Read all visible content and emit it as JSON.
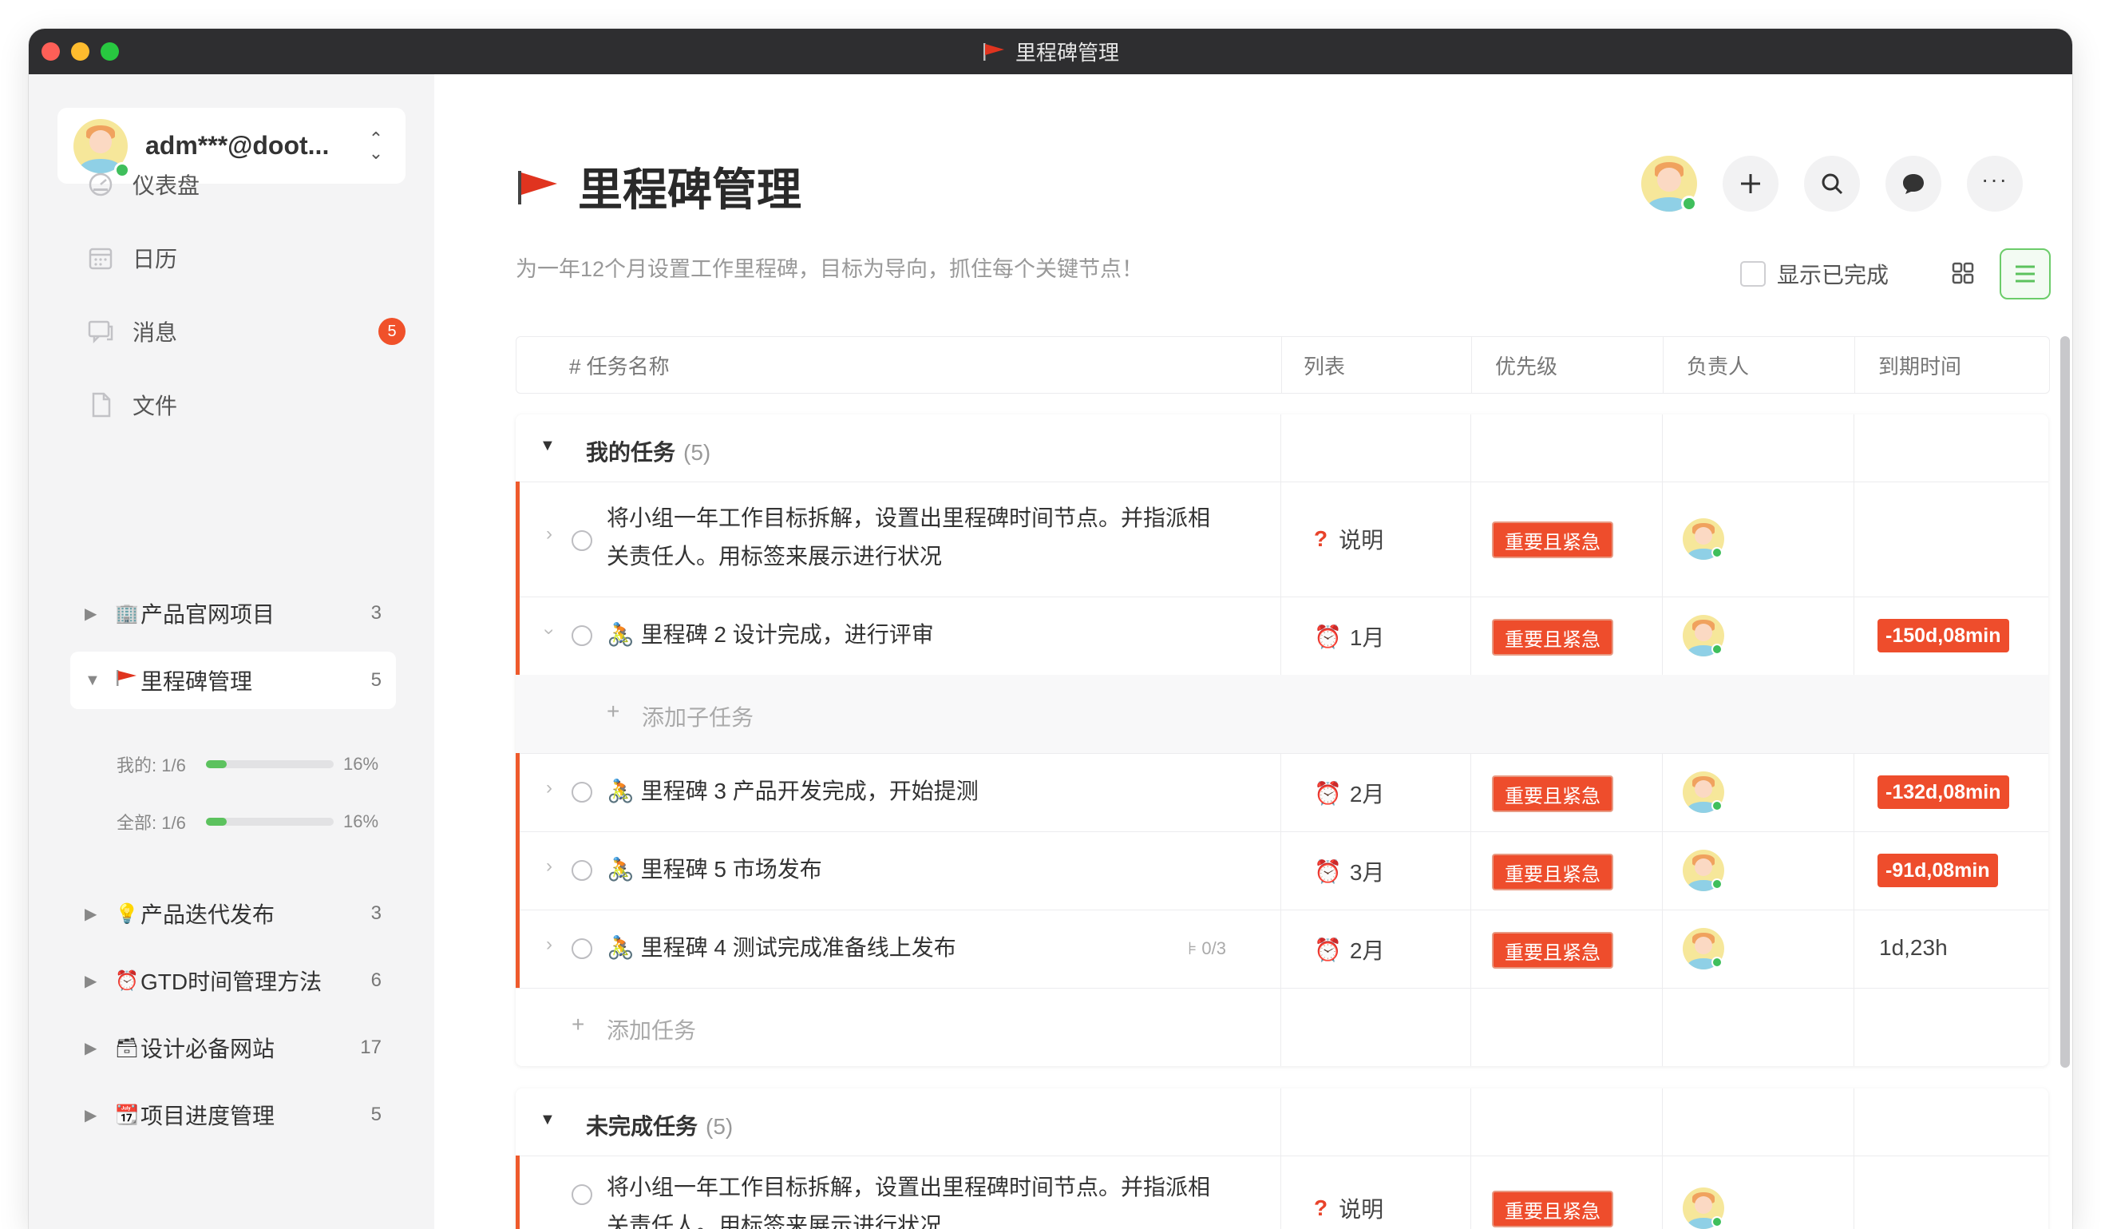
{
  "window": {
    "title": "里程碑管理"
  },
  "sidebar": {
    "account": {
      "name": "adm***@doot..."
    },
    "nav": [
      {
        "label": "仪表盘",
        "icon": "dashboard-icon"
      },
      {
        "label": "日历",
        "icon": "calendar-icon"
      },
      {
        "label": "消息",
        "icon": "message-icon",
        "badge": "5"
      },
      {
        "label": "文件",
        "icon": "file-icon"
      }
    ],
    "projects": [
      {
        "label": "产品官网项目",
        "icon": "🏢",
        "count": "3",
        "expanded": false
      },
      {
        "label": "里程碑管理",
        "icon": "flag",
        "count": "5",
        "expanded": true
      },
      {
        "label": "产品迭代发布",
        "icon": "💡",
        "count": "3",
        "expanded": false
      },
      {
        "label": "GTD时间管理方法",
        "icon": "⏰",
        "count": "6",
        "expanded": false
      },
      {
        "label": "设计必备网站",
        "icon": "🗃",
        "count": "17",
        "expanded": false
      },
      {
        "label": "项目进度管理",
        "icon": "📆",
        "count": "5",
        "expanded": false
      }
    ],
    "progress": [
      {
        "label": "我的: 1/6",
        "percent_text": "16%",
        "fraction": 0.16
      },
      {
        "label": "全部: 1/6",
        "percent_text": "16%",
        "fraction": 0.16
      }
    ]
  },
  "main": {
    "title": "里程碑管理",
    "subtitle": "为一年12个月设置工作里程碑，目标为导向，抓住每个关键节点！",
    "show_completed_label": "显示已完成",
    "columns": {
      "name": "# 任务名称",
      "list": "列表",
      "priority": "优先级",
      "owner": "负责人",
      "due": "到期时间"
    },
    "groups": [
      {
        "title": "我的任务",
        "count": "(5)",
        "tasks": [
          {
            "line1": "将小组一年工作目标拆解，设置出里程碑时间节点。并指派相",
            "line2": "关责任人。用标签来展示进行状况",
            "list": "说明",
            "priority": "重要且紧急",
            "due": ""
          },
          {
            "name": "🚴 里程碑 2 设计完成，进行评审",
            "list": "1月",
            "priority": "重要且紧急",
            "due": "-150d,08min"
          },
          {
            "name": "🚴 里程碑 3 产品开发完成，开始提测",
            "list": "2月",
            "priority": "重要且紧急",
            "due": "-132d,08min"
          },
          {
            "name": "🚴 里程碑 5 市场发布",
            "list": "3月",
            "priority": "重要且紧急",
            "due": "-91d,08min"
          },
          {
            "name": "🚴 里程碑 4 测试完成准备线上发布",
            "subtasks": "0/3",
            "list": "2月",
            "priority": "重要且紧急",
            "due": "1d,23h"
          }
        ],
        "add_subtask": "添加子任务",
        "add_task": "添加任务"
      },
      {
        "title": "未完成任务",
        "count": "(5)",
        "tasks": [
          {
            "line1": "将小组一年工作目标拆解，设置出里程碑时间节点。并指派相",
            "line2": "关责任人。用标签来展示进行状况",
            "list": "说明",
            "priority": "重要且紧急"
          }
        ]
      }
    ]
  },
  "colors": {
    "accent_green": "#6ccc6a",
    "urgent_red": "#ee4d2c",
    "flag_red": "#e0341f"
  }
}
